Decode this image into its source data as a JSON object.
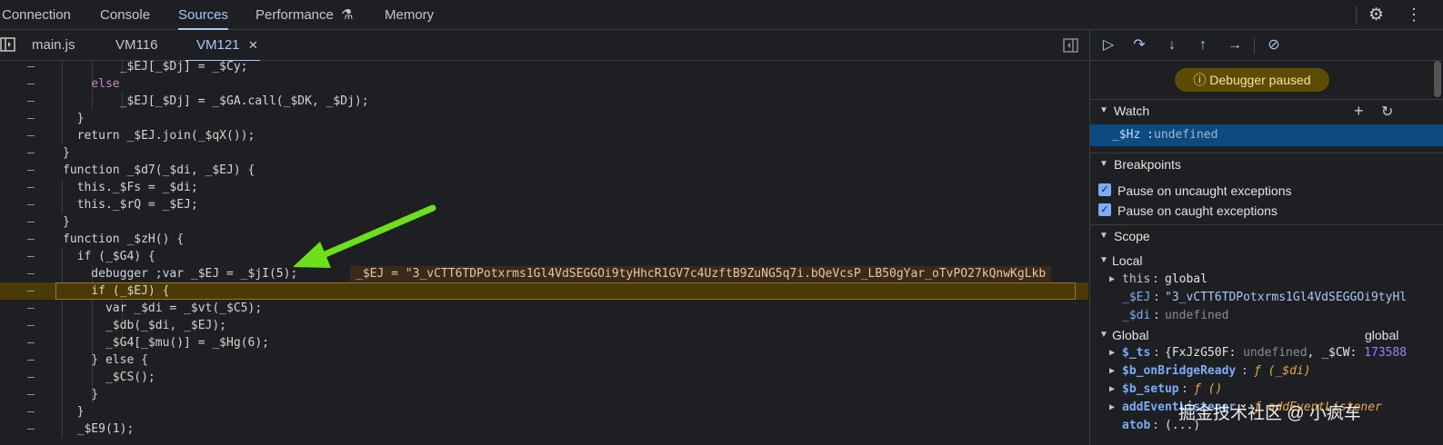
{
  "topbar": {
    "tabs": [
      "Connection",
      "Console",
      "Sources",
      "Performance",
      "Memory"
    ],
    "settings_icon": "gear-icon",
    "more_icon": "more-vertical-icon",
    "flask_icon": "flask-icon"
  },
  "filetabs": {
    "files": [
      "main.js",
      "VM116",
      "VM121"
    ],
    "close_glyph": "✕"
  },
  "editor": {
    "lines": [
      {
        "gutter": "–",
        "code": "        _$EJ[_$Dj] = _$Cy;"
      },
      {
        "gutter": "–",
        "code": "    else"
      },
      {
        "gutter": "–",
        "code": "        _$EJ[_$Dj] = _$GA.call(_$DK, _$Dj);"
      },
      {
        "gutter": "–",
        "code": "  }"
      },
      {
        "gutter": "–",
        "code": "  return _$EJ.join(_$qX());"
      },
      {
        "gutter": "–",
        "code": "}"
      },
      {
        "gutter": "–",
        "code": "function _$d7(_$di, _$EJ) {"
      },
      {
        "gutter": "–",
        "code": "  this._$Fs = _$di;"
      },
      {
        "gutter": "–",
        "code": "  this._$rQ = _$EJ;"
      },
      {
        "gutter": "–",
        "code": "}"
      },
      {
        "gutter": "–",
        "code": "function _$zH() {"
      },
      {
        "gutter": "–",
        "code": "  if (_$G4) {"
      },
      {
        "gutter": "–",
        "code": "    debugger ;var _$EJ = _$jI(5);"
      },
      {
        "gutter": "–",
        "code": "    if (_$EJ) {"
      },
      {
        "gutter": "–",
        "code": "      var _$di = _$vt(_$C5);"
      },
      {
        "gutter": "–",
        "code": "      _$db(_$di, _$EJ);"
      },
      {
        "gutter": "–",
        "code": "      _$G4[_$mu()] = _$Hg(6);"
      },
      {
        "gutter": "–",
        "code": "    } else {"
      },
      {
        "gutter": "–",
        "code": "      _$CS();"
      },
      {
        "gutter": "–",
        "code": "    }"
      },
      {
        "gutter": "–",
        "code": "  }"
      },
      {
        "gutter": "–",
        "code": "  _$E9(1);"
      }
    ],
    "inline_value": "_$EJ = \"3_vCTT6TDPotxrms1Gl4VdSEGGOi9tyHhcR1GV7c4UzftB9ZuNG5q7i.bQeVcsP_LB50gYar_oTvPO27kQnwKgLkb"
  },
  "debugger": {
    "paused_label": "Debugger paused",
    "watch": {
      "title": "Watch",
      "item_name": "_$Hz",
      "item_value": "undefined"
    },
    "breakpoints": {
      "title": "Breakpoints",
      "items": [
        "Pause on uncaught exceptions",
        "Pause on caught exceptions"
      ]
    },
    "scope": {
      "title": "Scope",
      "local_title": "Local",
      "this_name": "this",
      "this_value": "global",
      "ej_name": "_$EJ",
      "ej_value": "\"3_vCTT6TDPotxrms1Gl4VdSEGGOi9tyHl",
      "di_name": "_$di",
      "di_value": "undefined",
      "global_title": "Global",
      "global_value": "global",
      "ts_name": "$_ts",
      "ts_value_a": "{FxJzG50F: ",
      "ts_value_b": "undefined",
      "ts_value_c": ", _$CW: ",
      "ts_value_d": "173588",
      "bridge_name": "$b_onBridgeReady",
      "bridge_value": "ƒ (_$di)",
      "setup_name": "$b_setup",
      "setup_value": "ƒ ()",
      "listener_name": "addEventListener",
      "listener_value": "ƒ addEventListener",
      "atob_name": "atob",
      "atob_value": "(...)"
    }
  },
  "watermark": "掘金技术社区 @ 小疯车"
}
